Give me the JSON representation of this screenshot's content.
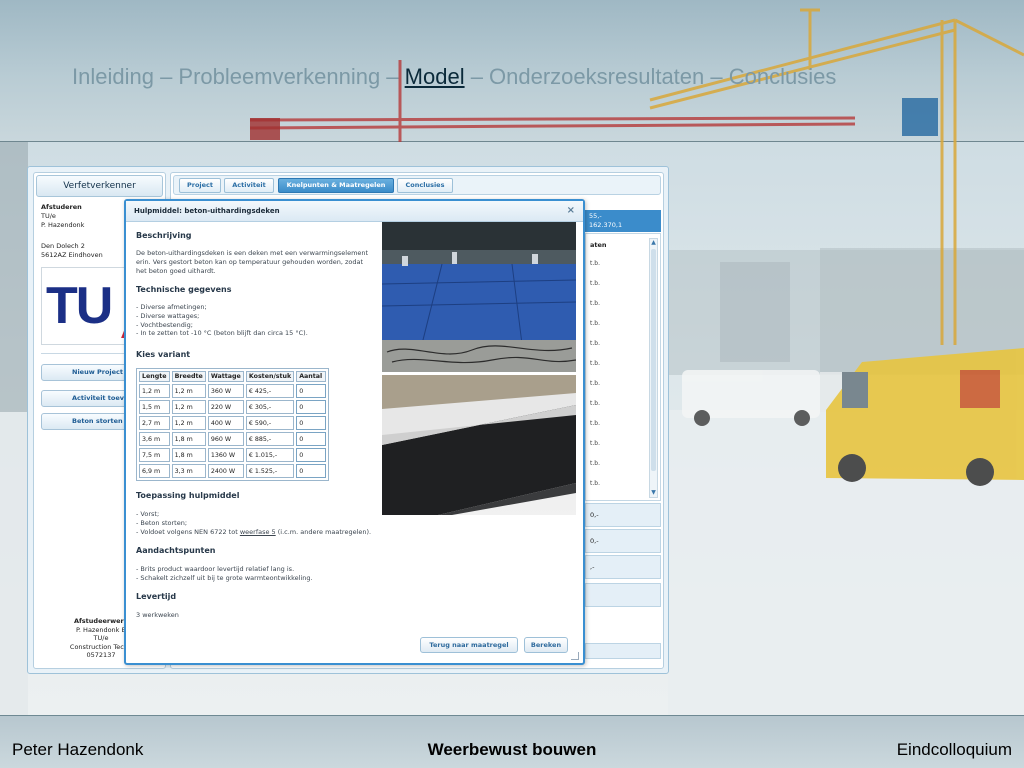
{
  "slide": {
    "nav_before": "Inleiding – Probleemverkenning – ",
    "nav_active": "Model",
    "nav_after": " – Onderzoeksresultaten – Conclusies",
    "footer_left": "Peter Hazendonk",
    "footer_center": "Weerbewust bouwen",
    "footer_right": "Eindcolloquium"
  },
  "app": {
    "left_header": "Verfetverkenner",
    "address_lines": [
      "Afstuderen",
      "TU/e",
      "P. Hazendonk"
    ],
    "address2_lines": [
      "Den Dolech 2",
      "5612AZ Eindhoven"
    ],
    "logo_text": "TU",
    "buttons": [
      "Nieuw Project",
      "Activiteit toevoegen",
      "Beton storten"
    ],
    "footer_lines": [
      "Afstudeerwerk",
      "P. Hazendonk B",
      "TU/e",
      "Construction Techn",
      "0572137"
    ],
    "tabs": [
      "Project",
      "Activiteit",
      "Knelpunten & Maatregelen",
      "Conclusies"
    ],
    "active_tab": "Knelpunten & Maatregelen",
    "behind_header": [
      "55,-",
      "162.370,1"
    ],
    "behind_list_header": "aten",
    "behind_list_items": [
      "t.b.",
      "t.b.",
      "t.b.",
      "t.b.",
      "t.b.",
      "t.b.",
      "t.b.",
      "t.b.",
      "t.b.",
      "t.b.",
      "t.b.",
      "t.b."
    ],
    "behind_rows": [
      "0,-",
      "0,-",
      ",-",
      ""
    ]
  },
  "modal": {
    "title": "Hulpmiddel: beton-uithardingsdeken",
    "close_symbol": "×",
    "sections": {
      "beschrijving_title": "Beschrijving",
      "beschrijving_text": "De beton-uithardingsdeken is een deken met een verwarmingselement erin. Vers gestort beton kan op temperatuur gehouden worden, zodat het beton goed uithardt.",
      "technisch_title": "Technische gegevens",
      "technisch_lines": [
        "- Diverse afmetingen;",
        "- Diverse wattages;",
        "- Vochtbestendig;",
        "- In te zetten tot -10 °C (beton blijft dan circa 15 °C)."
      ],
      "variant_title": "Kies variant",
      "toepassing_title": "Toepassing hulpmiddel",
      "toepassing_line1": "- Vorst;",
      "toepassing_line2": "- Beton storten;",
      "toepassing_line3_a": "- Voldoet volgens NEN 6722 tot ",
      "toepassing_line3_link": "weerfase 5",
      "toepassing_line3_b": " (i.c.m. andere maatregelen).",
      "aandacht_title": "Aandachtspunten",
      "aandacht_lines": [
        "- Brits product waardoor levertijd relatief lang is.",
        "- Schakelt zichzelf uit bij te grote warmteontwikkeling."
      ],
      "levertijd_title": "Levertijd",
      "levertijd_text": "3 werkweken"
    },
    "table": {
      "headers": [
        "Lengte",
        "Breedte",
        "Wattage",
        "Kosten/stuk",
        "Aantal"
      ],
      "rows": [
        [
          "1,2 m",
          "1,2 m",
          "360 W",
          "€ 425,-",
          "0"
        ],
        [
          "1,5 m",
          "1,2 m",
          "220 W",
          "€ 305,-",
          "0"
        ],
        [
          "2,7 m",
          "1,2 m",
          "400 W",
          "€ 590,-",
          "0"
        ],
        [
          "3,6 m",
          "1,8 m",
          "960 W",
          "€ 885,-",
          "0"
        ],
        [
          "7,5 m",
          "1,8 m",
          "1360 W",
          "€ 1.015,-",
          "0"
        ],
        [
          "6,9 m",
          "3,3 m",
          "2400 W",
          "€ 1.525,-",
          "0"
        ]
      ]
    },
    "buttons": {
      "back": "Terug naar maatregel",
      "calculate": "Bereken"
    }
  }
}
